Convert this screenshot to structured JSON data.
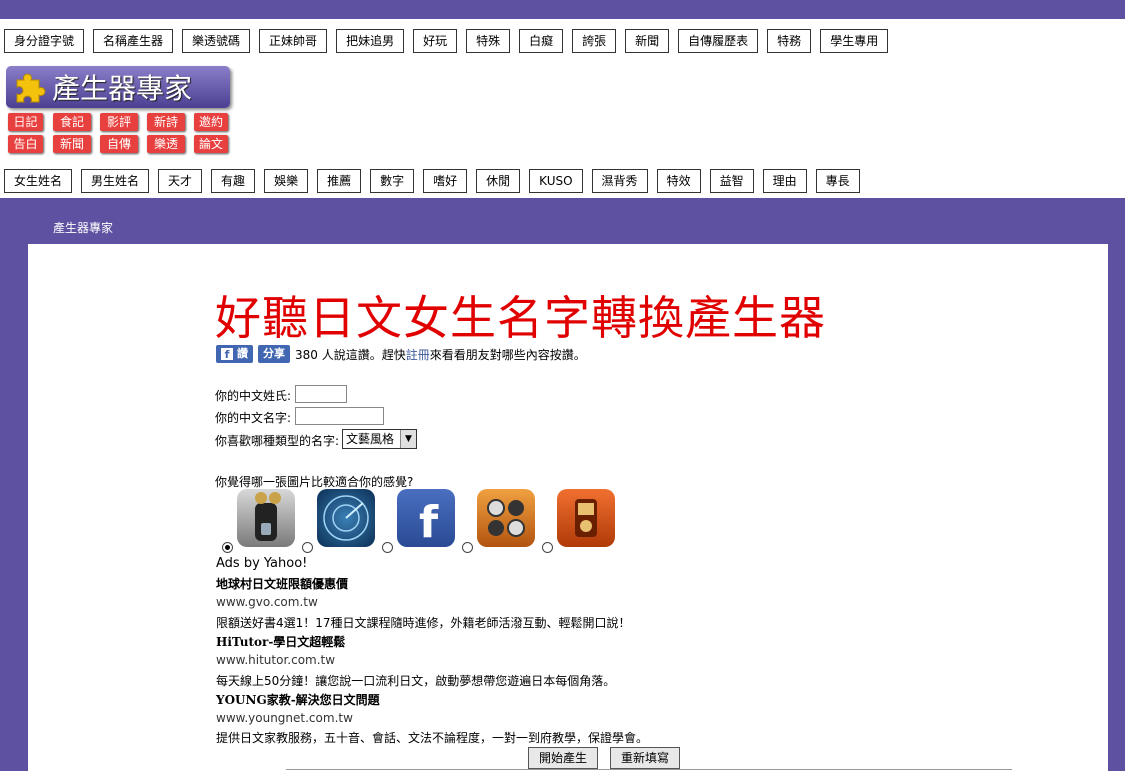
{
  "top_nav": [
    "身分證字號",
    "名稱產生器",
    "樂透號碼",
    "正妹帥哥",
    "把妹追男",
    "好玩",
    "特殊",
    "白癡",
    "誇張",
    "新聞",
    "自傳履歷表",
    "特務",
    "學生專用"
  ],
  "logo": {
    "title": "產生器專家"
  },
  "tags_row1": [
    "日記",
    "食記",
    "影評",
    "新詩",
    "邀約"
  ],
  "tags_row2": [
    "告白",
    "新聞",
    "自傳",
    "樂透",
    "論文"
  ],
  "second_nav": [
    "女生姓名",
    "男生姓名",
    "天才",
    "有趣",
    "娛樂",
    "推薦",
    "數字",
    "嗜好",
    "休閒",
    "KUSO",
    "濕背秀",
    "特效",
    "益智",
    "理由",
    "專長"
  ],
  "breadcrumb": "產生器專家",
  "page_title": "好聽日文女生名字轉換產生器",
  "facebook": {
    "like": "讚",
    "share": "分享",
    "text_before": "380 人說這讚。趕快",
    "register": "註冊",
    "text_after": "來看看朋友對哪些內容按讚。"
  },
  "form": {
    "surname_label": "你的中文姓氏:",
    "name_label": "你的中文名字:",
    "type_label": "你喜歡哪種類型的名字:",
    "type_value": "文藝風格",
    "image_question": "你覺得哪一張圖片比較適合你的感覺?",
    "image_icons": [
      "remote-app-icon",
      "radar-app-icon",
      "facebook-app-icon",
      "game-app-icon",
      "music-player-app-icon"
    ],
    "selected_image": 0
  },
  "ads": {
    "label": "Ads by Yahoo!",
    "items": [
      {
        "title": "地球村日文班限額優惠價",
        "url": "www.gvo.com.tw",
        "desc": "限額送好書4選1！17種日文課程隨時進修，外籍老師活潑互動、輕鬆開口說！"
      },
      {
        "title": "HiTutor-學日文超輕鬆",
        "url": "www.hitutor.com.tw",
        "desc": "每天線上50分鐘！讓您說一口流利日文，啟動夢想帶您遊遍日本每個角落。"
      },
      {
        "title": "YOUNG家教-解決您日文問題",
        "url": "www.youngnet.com.tw",
        "desc": "提供日文家教服務，五十音、會話、文法不論程度，一對一到府教學，保證學會。"
      }
    ]
  },
  "buttons": {
    "submit": "開始產生",
    "reset": "重新填寫"
  },
  "colors": {
    "header": "#5f51a1",
    "title": "#e00000",
    "tag": "#e8403f",
    "facebook": "#4267b2"
  }
}
